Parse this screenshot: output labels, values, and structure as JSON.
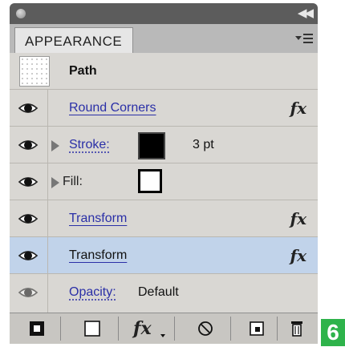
{
  "panel": {
    "tab_label": "APPEARANCE",
    "target_label": "Path"
  },
  "rows": [
    {
      "label": "Round Corners",
      "fx": "fx"
    },
    {
      "label": "Stroke:",
      "value": "3 pt"
    },
    {
      "label": "Fill:"
    },
    {
      "label": "Transform",
      "fx": "fx"
    },
    {
      "label": "Transform",
      "fx": "fx",
      "selected": true
    },
    {
      "label": "Opacity:",
      "value": "Default"
    }
  ],
  "toolbar": {
    "fx_label": "fx"
  },
  "badge": {
    "text": "6",
    "color": "#2eb34b"
  },
  "colors": {
    "selection": "#c1d3ea",
    "link": "#2a2fa7",
    "list_bg": "#d9d7d3"
  }
}
